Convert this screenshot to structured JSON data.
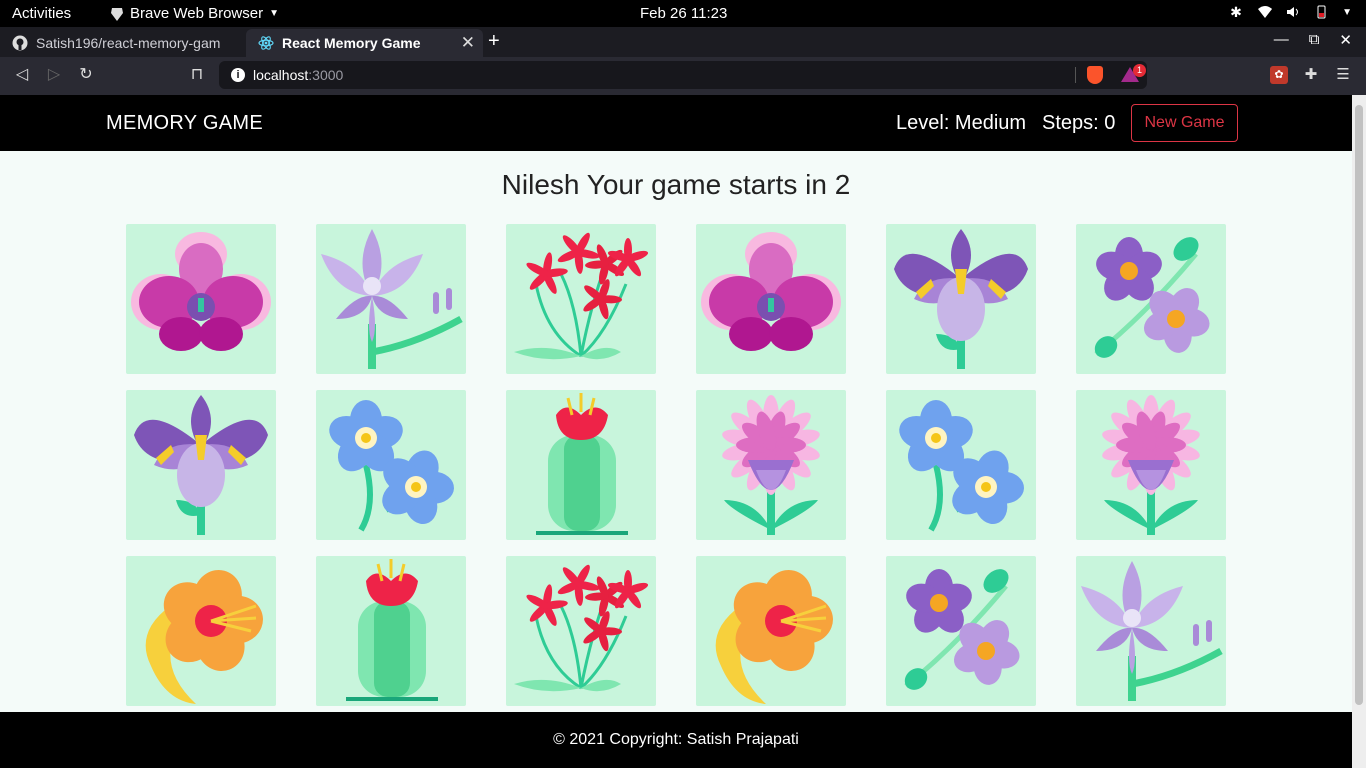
{
  "system": {
    "activities": "Activities",
    "app_name": "Brave Web Browser",
    "clock": "Feb 26  11:23"
  },
  "browser": {
    "tabs": [
      {
        "title": "Satish196/react-memory-gam",
        "active": false,
        "icon": "github-icon"
      },
      {
        "title": "React Memory Game",
        "active": true,
        "icon": "react-icon"
      }
    ],
    "url_host": "localhost",
    "url_port": ":3000",
    "rewards_badge": "1"
  },
  "app": {
    "brand": "MEMORY GAME",
    "level": "Level: Medium",
    "steps": "Steps: 0",
    "new_game_label": "New Game",
    "status": "Nilesh Your game starts in 2",
    "footer": "© 2021 Copyright: Satish Prajapati"
  },
  "cards": [
    {
      "flower": "orchid"
    },
    {
      "flower": "lavender-lily"
    },
    {
      "flower": "red-starflower"
    },
    {
      "flower": "orchid"
    },
    {
      "flower": "iris"
    },
    {
      "flower": "violet"
    },
    {
      "flower": "iris"
    },
    {
      "flower": "forget-me-not"
    },
    {
      "flower": "cactus-flower"
    },
    {
      "flower": "thistle"
    },
    {
      "flower": "forget-me-not"
    },
    {
      "flower": "thistle"
    },
    {
      "flower": "hibiscus"
    },
    {
      "flower": "cactus-flower"
    },
    {
      "flower": "red-starflower"
    },
    {
      "flower": "hibiscus"
    },
    {
      "flower": "violet"
    },
    {
      "flower": "lavender-lily"
    }
  ],
  "colors": {
    "card_bg": "#c8f5dc",
    "page_bg": "#f4fbf9",
    "danger": "#dc3545"
  }
}
